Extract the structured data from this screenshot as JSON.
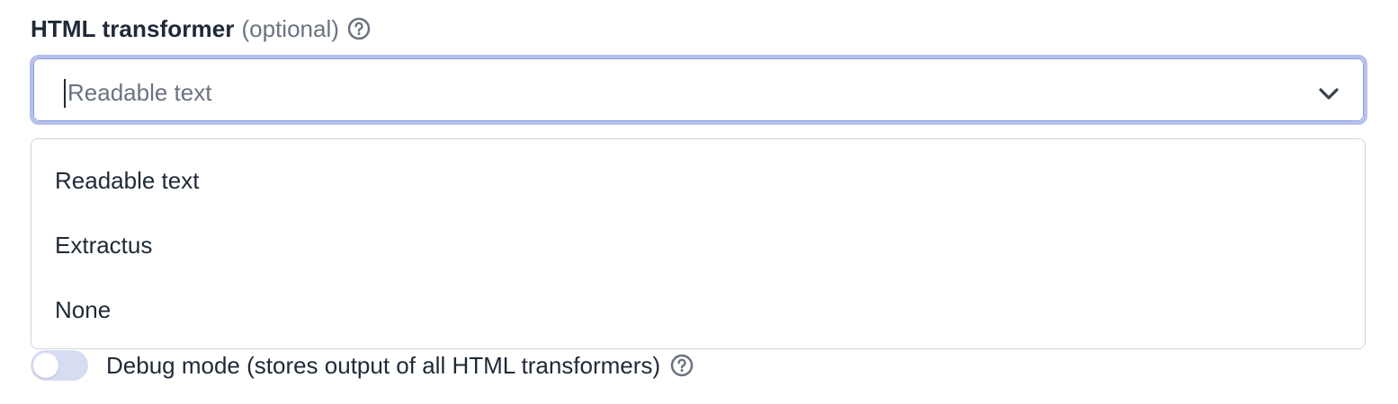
{
  "field": {
    "label": "HTML transformer",
    "optional_label": "(optional)",
    "help_icon": "question-circle-icon"
  },
  "select": {
    "placeholder": "Readable text",
    "chevron_icon": "chevron-down-icon",
    "focus_ring_color": "#b5c0ec"
  },
  "dropdown": {
    "options": [
      {
        "label": "Readable text"
      },
      {
        "label": "Extractus"
      },
      {
        "label": "None"
      }
    ]
  },
  "debug_toggle": {
    "label": "Debug mode (stores output of all HTML transformers)",
    "checked": false,
    "help_icon": "question-circle-icon",
    "track_color": "#d8dcf2"
  }
}
